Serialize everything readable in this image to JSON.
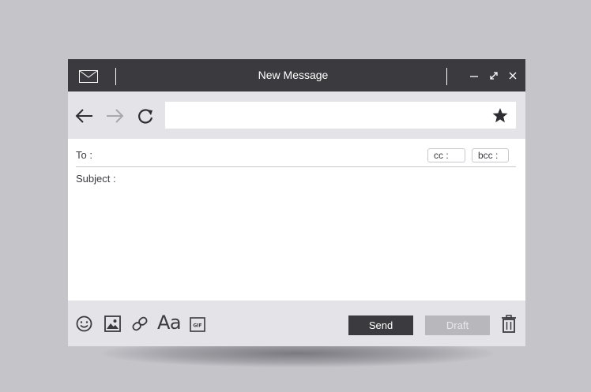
{
  "window": {
    "title": "New Message",
    "controls": [
      "minimize-icon",
      "expand-icon",
      "close-icon"
    ]
  },
  "navbar": {
    "url_value": "",
    "icons": [
      "back-arrow-icon",
      "forward-arrow-icon",
      "refresh-icon",
      "star-icon"
    ]
  },
  "compose": {
    "to_label": "To :",
    "cc_label": "cc :",
    "bcc_label": "bcc :",
    "subject_label": "Subject :",
    "body": ""
  },
  "toolbar": {
    "icons": [
      "emoji-icon",
      "image-icon",
      "link-icon",
      "font-icon",
      "gif-icon",
      "trash-icon"
    ],
    "font_label": "Aa",
    "gif_label": "GIF",
    "send_label": "Send",
    "draft_label": "Draft"
  },
  "colors": {
    "background": "#c5c4c9",
    "titlebar": "#3b3a3f",
    "toolbar_bg": "#e4e3e8",
    "send_bg": "#3b3a3f",
    "draft_bg": "#b8b7bc"
  }
}
